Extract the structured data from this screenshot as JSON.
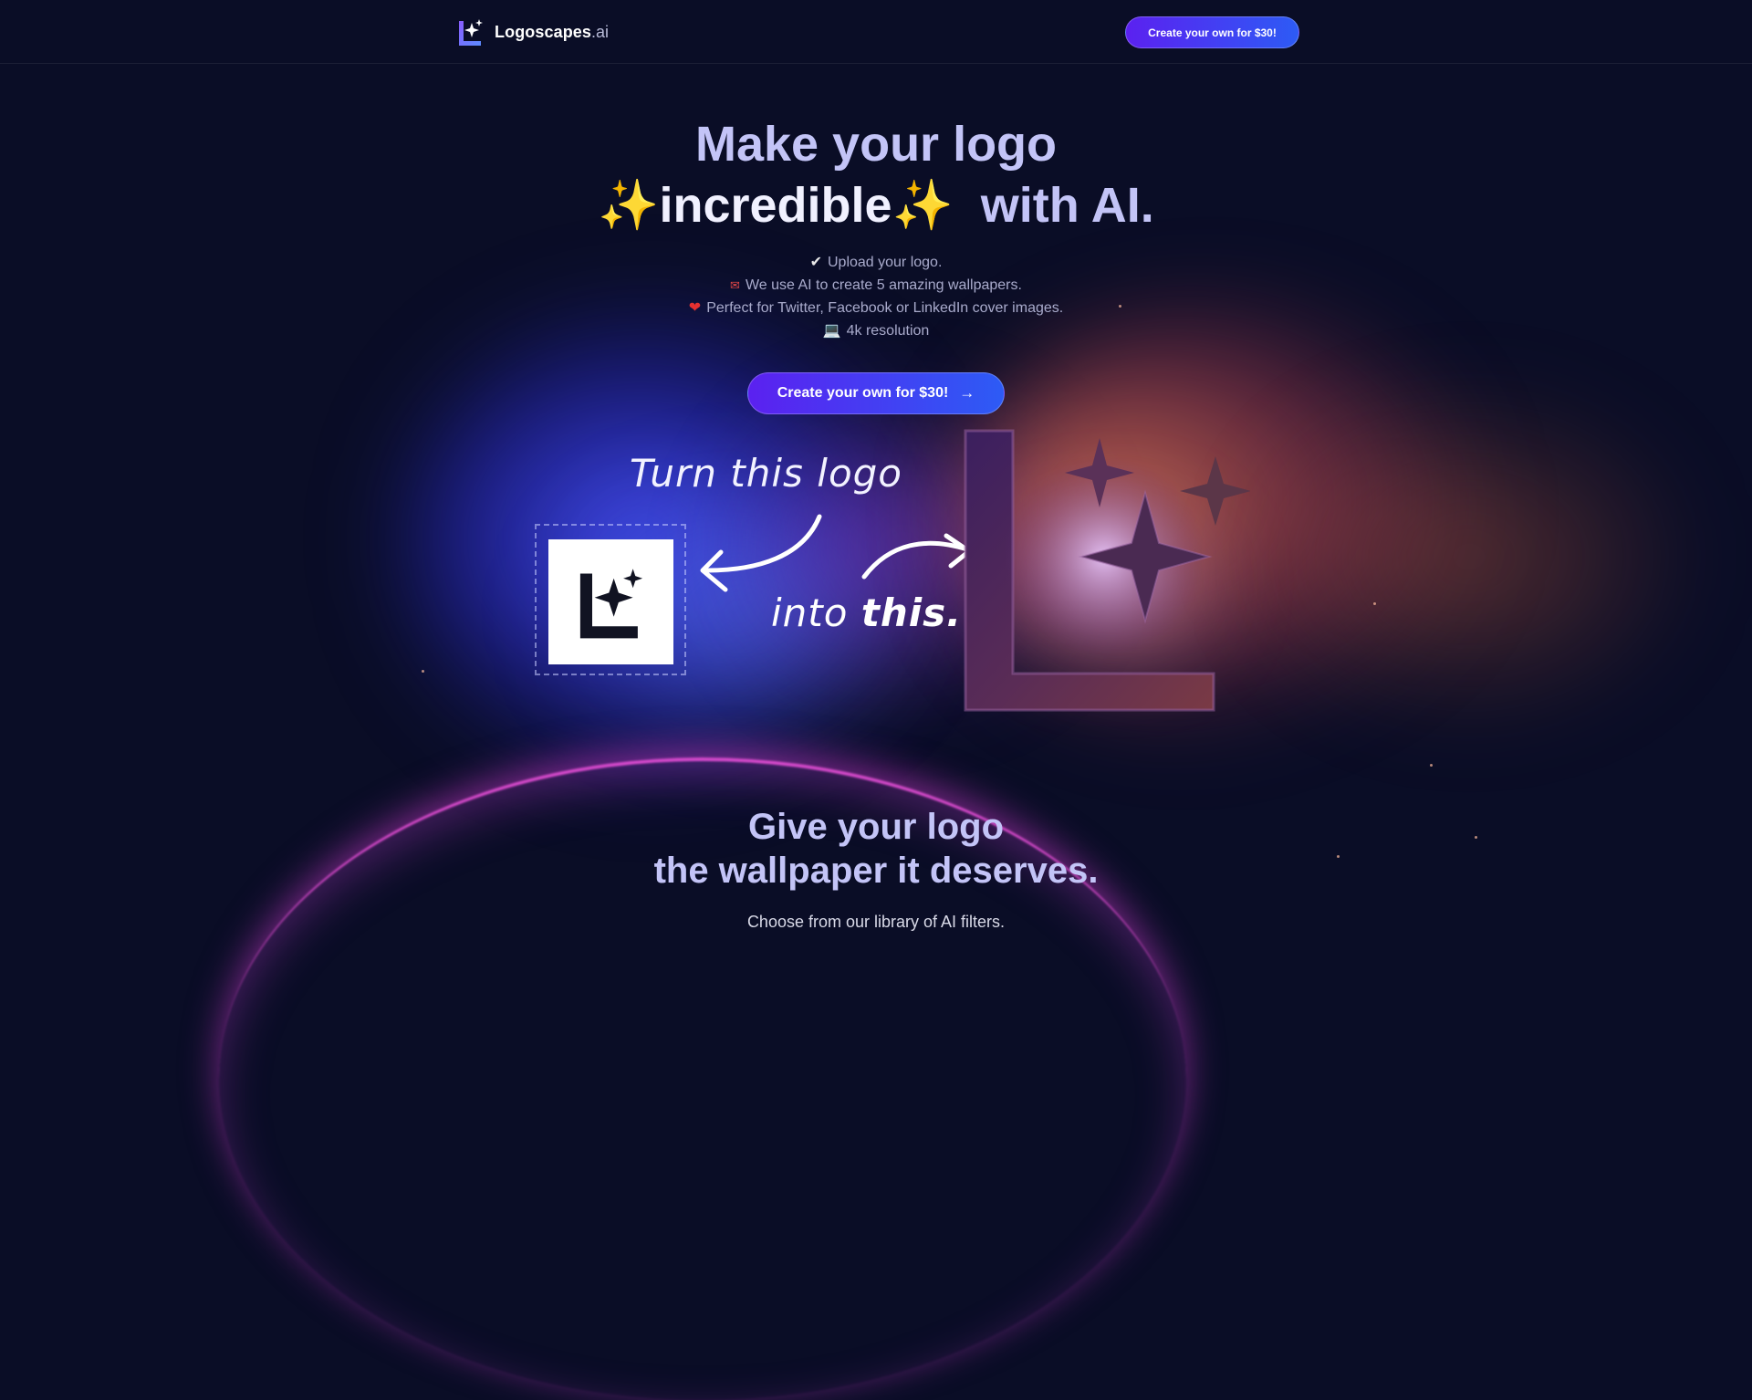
{
  "navbar": {
    "brand_name": "Logoscapes",
    "brand_tld": ".ai",
    "cta_label": "Create your own for $30!"
  },
  "hero": {
    "title_line1": "Make your logo",
    "sparkle": "✨",
    "highlight": "incredible",
    "title_suffix": "with AI.",
    "features": [
      {
        "icon": "check-icon",
        "text": "Upload your logo."
      },
      {
        "icon": "envelope-heart-icon",
        "text": "We use AI to create 5 amazing wallpapers."
      },
      {
        "icon": "heart-icon",
        "text": "Perfect for Twitter, Facebook or LinkedIn cover images."
      },
      {
        "icon": "laptop-icon",
        "text": "4k resolution"
      }
    ],
    "cta_label": "Create your own for $30!"
  },
  "demo": {
    "turn_text": "Turn this logo",
    "into_text": "into",
    "this_text": "this."
  },
  "section": {
    "title_line1": "Give your logo",
    "title_line2": "the wallpaper it deserves.",
    "subtitle": "Choose from our library of AI filters."
  },
  "colors": {
    "background": "#0a0d26",
    "heading": "#c3c4f7",
    "cta_gradient_start": "#5b21f0",
    "cta_gradient_end": "#2d5bf5",
    "sparkle": "#f6d541"
  }
}
